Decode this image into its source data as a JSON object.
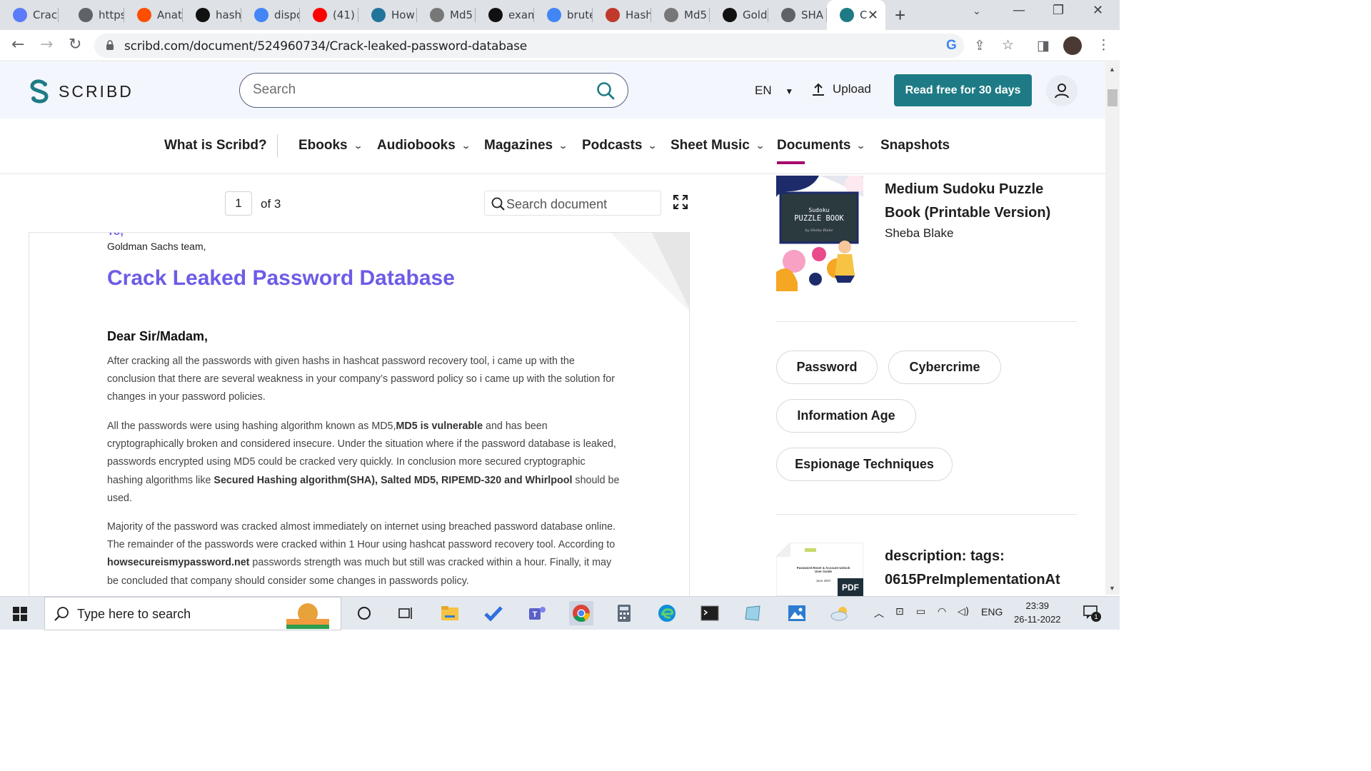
{
  "browser": {
    "tabs": [
      {
        "label": "Crack",
        "icon": "shield-tab-icon",
        "color": "#5b7cfa"
      },
      {
        "label": "https",
        "icon": "globe-tab-icon",
        "color": "#5f6368"
      },
      {
        "label": "Anat",
        "icon": "ars-tab-icon",
        "color": "#ff4e00"
      },
      {
        "label": "hash",
        "icon": "instapaper-tab-icon",
        "color": "#111111"
      },
      {
        "label": "dispo",
        "icon": "google-tab-icon",
        "color": "#4285f4"
      },
      {
        "label": "(41)",
        "icon": "youtube-tab-icon",
        "color": "#ff0000"
      },
      {
        "label": "How",
        "icon": "wordpress-tab-icon",
        "color": "#21759b"
      },
      {
        "label": "Md5",
        "icon": "binary-tab-icon",
        "color": "#777777"
      },
      {
        "label": "exam",
        "icon": "instapaper-tab-icon",
        "color": "#111111"
      },
      {
        "label": "brute",
        "icon": "google-tab-icon",
        "color": "#4285f4"
      },
      {
        "label": "Hash",
        "icon": "in-tab-icon",
        "color": "#c0392b"
      },
      {
        "label": "Md5",
        "icon": "binary-tab-icon",
        "color": "#777777"
      },
      {
        "label": "Gold",
        "icon": "github-tab-icon",
        "color": "#111111"
      },
      {
        "label": "SHA",
        "icon": "globe-tab-icon",
        "color": "#5f6368"
      },
      {
        "label": "C",
        "icon": "scribd-tab-icon",
        "color": "#1e7b85",
        "active": true
      }
    ],
    "url": "scribd.com/document/524960734/Crack-leaked-password-database"
  },
  "header": {
    "logo": "SCRIBD",
    "search_placeholder": "Search",
    "language": "EN",
    "upload": "Upload",
    "cta": "Read free for 30 days",
    "accent": "#1e7b85"
  },
  "nav": {
    "items": [
      {
        "label": "What is Scribd?",
        "dropdown": false
      },
      {
        "label": "Ebooks",
        "dropdown": true
      },
      {
        "label": "Audiobooks",
        "dropdown": true
      },
      {
        "label": "Magazines",
        "dropdown": true
      },
      {
        "label": "Podcasts",
        "dropdown": true
      },
      {
        "label": "Sheet Music",
        "dropdown": true
      },
      {
        "label": "Documents",
        "dropdown": true,
        "active": true
      },
      {
        "label": "Snapshots",
        "dropdown": false
      }
    ],
    "active_color": "#a5006a"
  },
  "viewer": {
    "page": "1",
    "of": "of 3",
    "search_placeholder": "Search document"
  },
  "document": {
    "partial_heading": "To,",
    "recipient": "Goldman Sachs team,",
    "title": "Crack Leaked Password Database",
    "salutation": "Dear Sir/Madam,",
    "para1": "After cracking all the passwords with given hashs in hashcat password recovery tool, i came up with the conclusion that there are several weakness in your company’s password policy so i came up with the solution for changes in your password policies.",
    "para2_a": "All the passwords were using  hashing algorithm known as  MD5,",
    "para2_b": "MD5 is vulnerable",
    "para2_c": " and has been cryptographically broken and considered insecure. Under the situation where if the password database is leaked, passwords encrypted using MD5 could be cracked very quickly. In conclusion more secured cryptographic hashing algorithms like ",
    "para2_d": "Secured Hashing algorithm(SHA), Salted MD5, RIPEMD-320 and Whirlpool",
    "para2_e": " should be used.",
    "para3_a": "Majority of the password was cracked almost immediately on internet using breached password database online. The remainder of the passwords were cracked within 1 Hour using hashcat password recovery tool. According  to ",
    "para3_b": "howsecureismypassword.net",
    "para3_c": " passwords strength was much but still was cracked within a hour. Finally, it may be concluded that  company should consider some changes in passwords policy.",
    "title_color": "#6c5ce7"
  },
  "sidebar": {
    "book1": {
      "title": "Medium Sudoku Puzzle Book (Printable Version)",
      "author": "Sheba Blake",
      "cover_line1": "Sudoku",
      "cover_line2": "PUZZLE BOOK",
      "cover_line3": "by Sheba Blake"
    },
    "tags": [
      "Password",
      "Cybercrime",
      "Information Age",
      "Espionage Techniques"
    ],
    "doc2": {
      "title_line1": "description: tags:",
      "title_line2": "0615PreImplementationAt",
      "badge": "PDF",
      "thumb_title": "Password Reset & Account Unlock User Guide",
      "thumb_date": "June 2007"
    }
  },
  "taskbar": {
    "search_placeholder": "Type here to search",
    "language": "ENG",
    "time": "23:39",
    "date": "26-11-2022",
    "notifications": "1"
  }
}
